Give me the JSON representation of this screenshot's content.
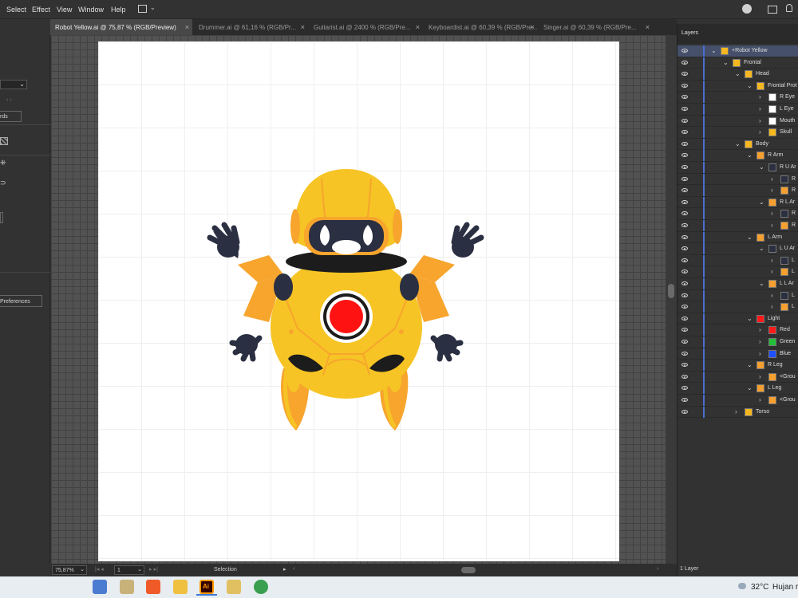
{
  "menu": [
    "Select",
    "Effect",
    "View",
    "Window",
    "Help"
  ],
  "tabs": [
    {
      "label": "Robot Yellow.ai @ 75,87 % (RGB/Preview)",
      "active": true
    },
    {
      "label": "Drummer.ai @ 61,16 % (RGB/Pr...",
      "active": false
    },
    {
      "label": "Guitarist.ai @ 2400 % (RGB/Pre...",
      "active": false
    },
    {
      "label": "Keyboardist.ai @ 60,39 % (RGB/Pre...",
      "active": false
    },
    {
      "label": "Singer.ai @ 60,39 % (RGB/Pre...",
      "active": false
    }
  ],
  "tab_close": "×",
  "left_panel": {
    "boards_label": "rds",
    "preferences_label": "Preferences"
  },
  "layers_panel": {
    "title": "Layers",
    "footer": "1 Layer",
    "rows": [
      {
        "name": "+Robot Yellow",
        "depth": 0,
        "expanded": true,
        "selected": true,
        "thumb": "#f6b820"
      },
      {
        "name": "Frontal",
        "depth": 1,
        "expanded": true,
        "thumb": "#f6b820"
      },
      {
        "name": "Head",
        "depth": 2,
        "expanded": true,
        "thumb": "#f6b820"
      },
      {
        "name": "Frontal Prot",
        "depth": 3,
        "expanded": true,
        "thumb": "#f6b820"
      },
      {
        "name": "R Eye",
        "depth": 4,
        "expanded": false,
        "thumb": "#ffffff"
      },
      {
        "name": "L Eye",
        "depth": 4,
        "expanded": false,
        "thumb": "#ffffff"
      },
      {
        "name": "Mouth",
        "depth": 4,
        "expanded": false,
        "thumb": "#ffffff"
      },
      {
        "name": "Skull",
        "depth": 4,
        "expanded": false,
        "thumb": "#f6b820"
      },
      {
        "name": "Body",
        "depth": 2,
        "expanded": true,
        "thumb": "#f6b820"
      },
      {
        "name": "R Arm",
        "depth": 3,
        "expanded": true,
        "thumb": "#f6a030"
      },
      {
        "name": "R U Ar",
        "depth": 4,
        "expanded": true,
        "thumb": "#2b3040"
      },
      {
        "name": "R",
        "depth": 5,
        "expanded": false,
        "thumb": "#2b3040"
      },
      {
        "name": "R",
        "depth": 5,
        "expanded": false,
        "thumb": "#f6a030"
      },
      {
        "name": "R L Ar",
        "depth": 4,
        "expanded": true,
        "thumb": "#f6a030"
      },
      {
        "name": "R",
        "depth": 5,
        "expanded": false,
        "thumb": "#2b3040"
      },
      {
        "name": "R",
        "depth": 5,
        "expanded": false,
        "thumb": "#f6a030"
      },
      {
        "name": "L Arm",
        "depth": 3,
        "expanded": true,
        "thumb": "#f6a030"
      },
      {
        "name": "L U Ar",
        "depth": 4,
        "expanded": true,
        "thumb": "#2b3040"
      },
      {
        "name": "L",
        "depth": 5,
        "expanded": false,
        "thumb": "#2b3040"
      },
      {
        "name": "L",
        "depth": 5,
        "expanded": false,
        "thumb": "#f6a030"
      },
      {
        "name": "L L Ar",
        "depth": 4,
        "expanded": true,
        "thumb": "#f6a030"
      },
      {
        "name": "L",
        "depth": 5,
        "expanded": false,
        "thumb": "#2b3040"
      },
      {
        "name": "L",
        "depth": 5,
        "expanded": false,
        "thumb": "#f6a030"
      },
      {
        "name": "Light",
        "depth": 3,
        "expanded": true,
        "thumb": "#ff1a1a"
      },
      {
        "name": "Red",
        "depth": 4,
        "expanded": false,
        "thumb": "#ff1a1a"
      },
      {
        "name": "Green",
        "depth": 4,
        "expanded": false,
        "thumb": "#22c03a"
      },
      {
        "name": "Blue",
        "depth": 4,
        "expanded": false,
        "thumb": "#2050ff"
      },
      {
        "name": "R Leg",
        "depth": 3,
        "expanded": true,
        "thumb": "#f6a030"
      },
      {
        "name": "<Grou",
        "depth": 4,
        "expanded": false,
        "thumb": "#f6a030"
      },
      {
        "name": "L Leg",
        "depth": 3,
        "expanded": true,
        "thumb": "#f6a030"
      },
      {
        "name": "<Grou",
        "depth": 4,
        "expanded": false,
        "thumb": "#f6a030"
      },
      {
        "name": "Torso",
        "depth": 2,
        "expanded": false,
        "thumb": "#f6b820"
      }
    ]
  },
  "status": {
    "zoom": "75,87%",
    "artboard": "1",
    "tool": "Selection"
  },
  "taskbar": {
    "temperature": "32°C",
    "weather": "Hujan r"
  },
  "colors": {
    "robot_yellow": "#f6c425",
    "robot_orange": "#f7a52d",
    "robot_dark": "#2b2f42",
    "light_red": "#ff1212"
  }
}
